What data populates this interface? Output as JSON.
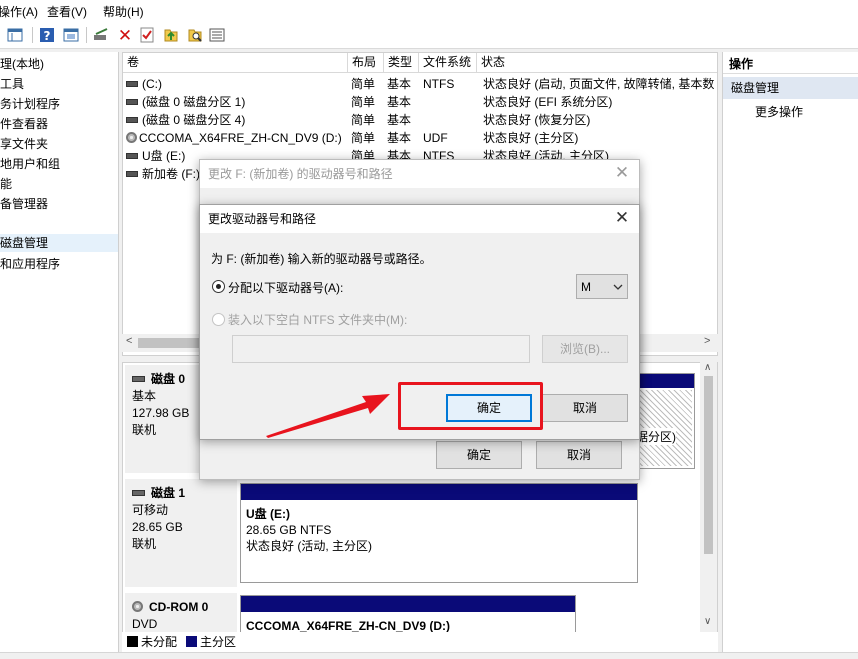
{
  "menu": {
    "action": "操作(A)",
    "view": "查看(V)",
    "help": "帮助(H)"
  },
  "toolbar": {
    "icons": [
      "back-icon",
      "properties-icon",
      "help-icon",
      "console-icon",
      "connect-icon",
      "delete-icon",
      "checklist-icon",
      "upload-icon",
      "search-icon",
      "list-icon"
    ]
  },
  "tree": {
    "items": [
      "理(本地)",
      "工具",
      "务计划程序",
      "件查看器",
      "享文件夹",
      "地用户和组",
      "能",
      "备管理器",
      "磁盘管理",
      "和应用程序"
    ]
  },
  "volumes": {
    "headers": [
      "卷",
      "布局",
      "类型",
      "文件系统",
      "状态"
    ],
    "rows": [
      {
        "name": "(C:)",
        "layout": "简单",
        "type": "基本",
        "fs": "NTFS",
        "status": "状态良好 (启动, 页面文件, 故障转储, 基本数"
      },
      {
        "name": "(磁盘 0 磁盘分区 1)",
        "layout": "简单",
        "type": "基本",
        "fs": "",
        "status": "状态良好 (EFI 系统分区)"
      },
      {
        "name": "(磁盘 0 磁盘分区 4)",
        "layout": "简单",
        "type": "基本",
        "fs": "",
        "status": "状态良好 (恢复分区)"
      },
      {
        "name": "CCCOMA_X64FRE_ZH-CN_DV9 (D:)",
        "layout": "简单",
        "type": "基本",
        "fs": "UDF",
        "status": "状态良好 (主分区)"
      },
      {
        "name": "U盘 (E:)",
        "layout": "简单",
        "type": "基本",
        "fs": "NTFS",
        "status": "状态良好 (活动, 主分区)"
      },
      {
        "name": "新加卷 (F:)",
        "layout": "",
        "type": "",
        "fs": "",
        "status": ""
      }
    ]
  },
  "disks": {
    "disk0": {
      "name": "磁盘 0",
      "kind": "基本",
      "size": "127.98 GB",
      "state": "联机",
      "partial_text": "据分区)"
    },
    "disk1": {
      "name": "磁盘 1",
      "kind": "可移动",
      "size": "28.65 GB",
      "state": "联机",
      "part_name": "U盘  (E:)",
      "part_size": "28.65 GB NTFS",
      "part_status": "状态良好 (活动, 主分区)"
    },
    "cdrom0": {
      "name": "CD-ROM 0",
      "kind": "DVD",
      "part_name": "CCCOMA_X64FRE_ZH-CN_DV9  (D:)"
    }
  },
  "legend": {
    "unallocated": "未分配",
    "primary": "主分区"
  },
  "actions": {
    "header": "操作",
    "section": "磁盘管理",
    "more": "更多操作"
  },
  "outer_dialog": {
    "title": "更改 F: (新加卷) 的驱动器号和路径",
    "ok": "确定",
    "cancel": "取消"
  },
  "inner_dialog": {
    "title": "更改驱动器号和路径",
    "prompt": "为 F: (新加卷) 输入新的驱动器号或路径。",
    "assign_label": "分配以下驱动器号(A):",
    "letter": "M",
    "mount_label": "装入以下空白 NTFS 文件夹中(M):",
    "browse": "浏览(B)...",
    "ok": "确定",
    "cancel": "取消"
  },
  "colors": {
    "partition_bar": "#0a0a78",
    "highlight": "#e8141e",
    "focus": "#0078d7"
  }
}
